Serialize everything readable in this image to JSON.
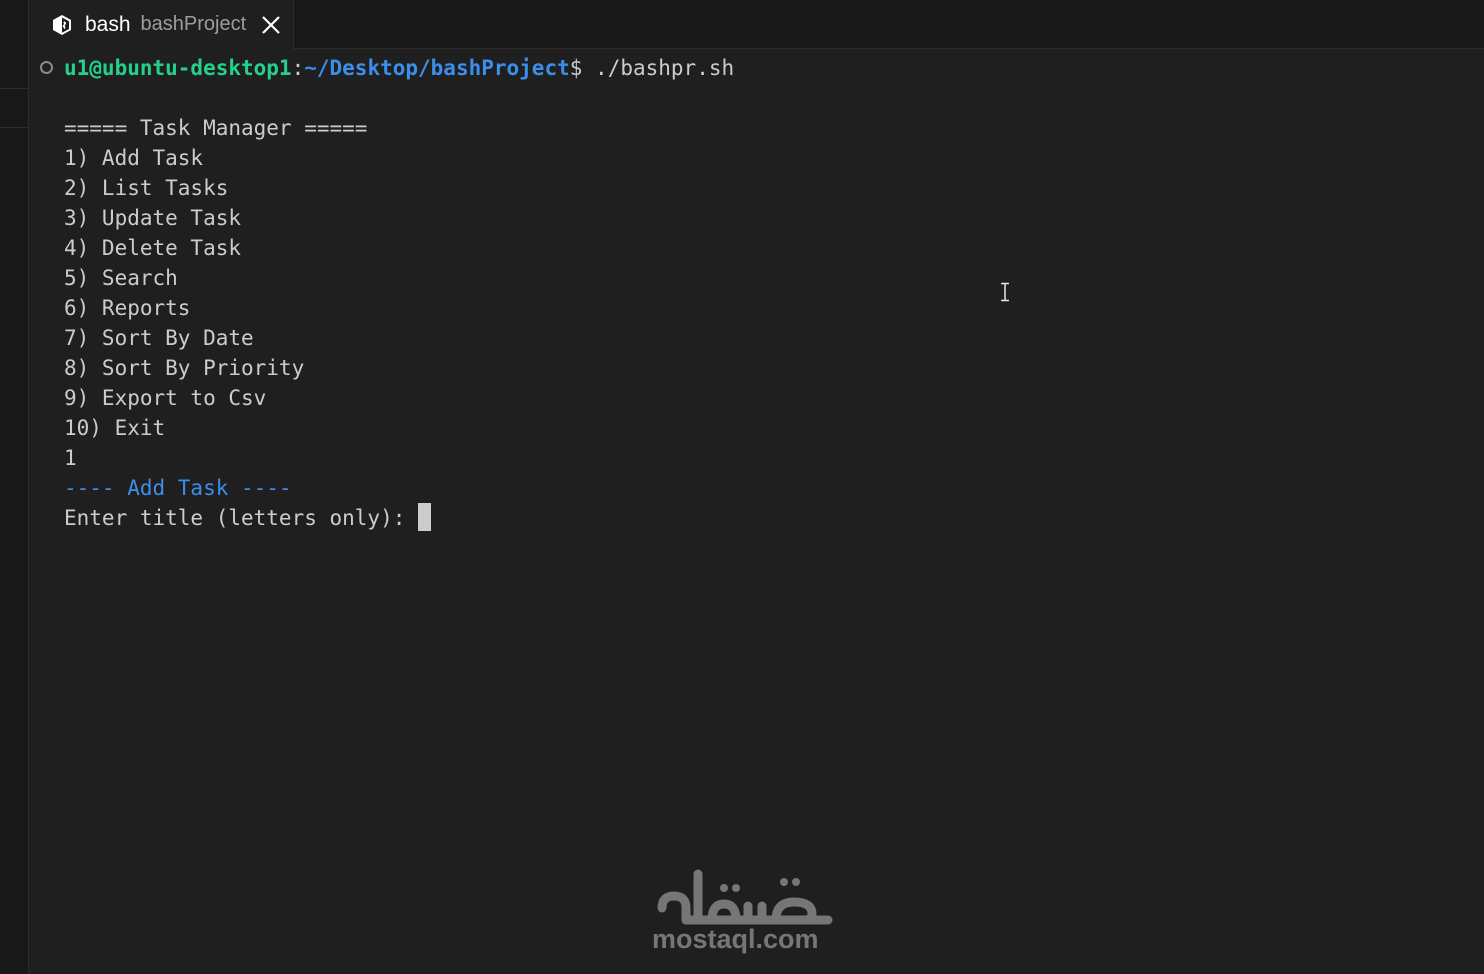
{
  "tab": {
    "title": "bash",
    "description": "bashProject",
    "icon": "terminal-bash-icon",
    "close_icon": "close-icon"
  },
  "prompt": {
    "user_host": "u1@ubuntu-desktop1",
    "colon": ":",
    "path": "~/Desktop/bashProject",
    "dollar": "$",
    "command": " ./bashpr.sh"
  },
  "menu": {
    "header": "===== Task Manager =====",
    "items": [
      "1) Add Task",
      "2) List Tasks",
      "3) Update Task",
      "4) Delete Task",
      "5) Search",
      "6) Reports",
      "7) Sort By Date",
      "8) Sort By Priority",
      "9) Export to Csv",
      "10) Exit"
    ]
  },
  "session": {
    "user_choice": "1",
    "section_header": "---- Add Task ----",
    "input_prompt": "Enter title (letters only): "
  },
  "watermark": {
    "logo_text": "مستقل",
    "site": "mostaql.com"
  },
  "colors": {
    "background": "#1f1f1f",
    "prompt_user": "#23d18b",
    "prompt_path": "#3b8eea",
    "text": "#cccccc"
  }
}
